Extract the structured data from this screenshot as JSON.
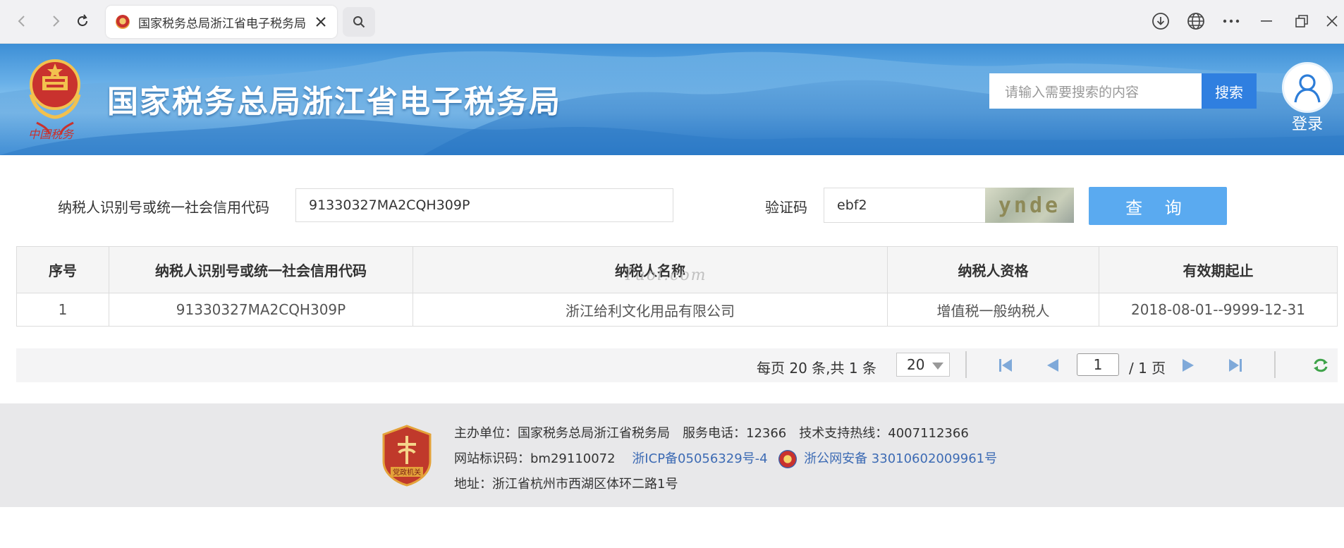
{
  "browser": {
    "tab_title": "国家税务总局浙江省电子税务局",
    "icons": [
      "back-icon",
      "forward-icon",
      "refresh-icon",
      "close-icon",
      "search-icon",
      "download-icon",
      "globe-icon",
      "more-icon",
      "minimize-icon",
      "restore-icon",
      "window-close-icon"
    ]
  },
  "header": {
    "site_title": "国家税务总局浙江省电子税务局",
    "search_placeholder": "请输入需要搜索的内容",
    "search_button": "搜索",
    "login_label": "登录"
  },
  "query": {
    "taxpayer_label": "纳税人识别号或统一社会信用代码",
    "taxpayer_value": "91330327MA2CQH309P",
    "captcha_label": "验证码",
    "captcha_value": "ebf2",
    "captcha_image_text": "ynde",
    "submit_label": "查 询"
  },
  "table": {
    "headers": [
      "序号",
      "纳税人识别号或统一社会信用代码",
      "纳税人名称",
      "纳税人资格",
      "有效期起止"
    ],
    "rows": [
      [
        "1",
        "91330327MA2CQH309P",
        "浙江给利文化用品有限公司",
        "增值税一般纳税人",
        "2018-08-01--9999-12-31"
      ]
    ],
    "watermark": "Tuol.com"
  },
  "pagination": {
    "summary": "每页 20 条,共 1 条",
    "page_size": "20",
    "current_page": "1",
    "total_pages": "/ 1 页"
  },
  "footer": {
    "line1": "主办单位：国家税务总局浙江省税务局　服务电话：12366　技术支持热线：4007112366",
    "site_id": "网站标识码：bm29110072",
    "icp": "浙ICP备05056329号-4",
    "police": "浙公网安备 33010602009961号",
    "address": "地址：浙江省杭州市西湖区体环二路1号"
  },
  "colors": {
    "search_button": "#2f7fe0",
    "query_button": "#5aaaf0",
    "link": "#3d6bb4"
  }
}
